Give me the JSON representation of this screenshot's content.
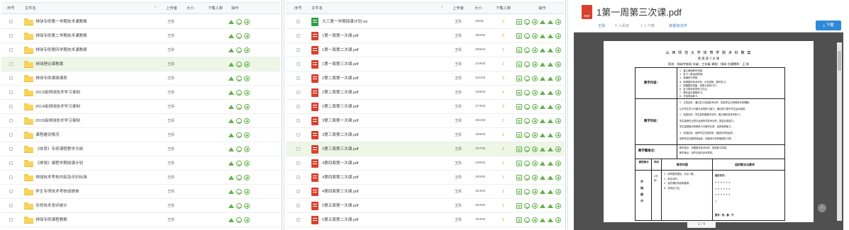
{
  "left": {
    "headers": {
      "index": "序号",
      "filename": "文件名",
      "uploader": "上传者",
      "size": "大小",
      "downloads": "下载人数",
      "actions": "操作"
    },
    "rows": [
      {
        "name": "排球专修第一学期技术课教案",
        "uploader": "王彤",
        "size": "",
        "downloads": ""
      },
      {
        "name": "排球专修第二学期技术课教案",
        "uploader": "王彤",
        "size": "",
        "downloads": ""
      },
      {
        "name": "排球专修第四学期技术课教案",
        "uploader": "王彤",
        "size": "",
        "downloads": ""
      },
      {
        "name": "排球理论课教案",
        "uploader": "王彤",
        "size": "",
        "downloads": ""
      },
      {
        "name": "排球专修课授课表",
        "uploader": "王彤",
        "size": "",
        "downloads": ""
      },
      {
        "name": "2013级排球技术学习录制",
        "uploader": "王彤",
        "size": "",
        "downloads": ""
      },
      {
        "name": "2014级排球技术学习录制",
        "uploader": "王彤",
        "size": "",
        "downloads": ""
      },
      {
        "name": "2015级排球技术学习录制",
        "uploader": "王彤",
        "size": "",
        "downloads": ""
      },
      {
        "name": "课程建设情况",
        "uploader": "王彤",
        "size": "",
        "downloads": ""
      },
      {
        "name": "《体育》专修课程教学大纲",
        "uploader": "王彤",
        "size": "",
        "downloads": ""
      },
      {
        "name": "《排球》课程学期授课计划",
        "uploader": "王彤",
        "size": "",
        "downloads": ""
      },
      {
        "name": "排球技术考核内容及评价标准",
        "uploader": "王彤",
        "size": "",
        "downloads": ""
      },
      {
        "name": "学生专项技术考核成绩单",
        "uploader": "王彤",
        "size": "",
        "downloads": ""
      },
      {
        "name": "专修技术测评统计",
        "uploader": "王彤",
        "size": "",
        "downloads": ""
      },
      {
        "name": "排球专修课程教案",
        "uploader": "王彤",
        "size": "",
        "downloads": ""
      }
    ]
  },
  "middle": {
    "headers": {
      "index": "序号",
      "filename": "文件名",
      "uploader": "上传者",
      "size": "大小",
      "downloads": "下载人数",
      "actions": "操作"
    },
    "rows": [
      {
        "name": "大三第一学期授课计划.xls",
        "type": "xls",
        "uploader": "王彤",
        "size": "28KB",
        "downloads": "0"
      },
      {
        "name": "1第一周第一次课.pdf",
        "type": "pdf",
        "uploader": "王彤",
        "size": "300KB",
        "downloads": "0"
      },
      {
        "name": "1第一周第二次课.pdf",
        "type": "pdf",
        "uploader": "王彤",
        "size": "305KB",
        "downloads": "1"
      },
      {
        "name": "1第一周第三次课.pdf",
        "type": "pdf",
        "uploader": "王彤",
        "size": "319KB",
        "downloads": "2"
      },
      {
        "name": "2第二周第一次课.pdf",
        "type": "pdf",
        "uploader": "王彤",
        "size": "341KB",
        "downloads": "3"
      },
      {
        "name": "2第二周第二次课.pdf",
        "type": "pdf",
        "uploader": "王彤",
        "size": "266KB",
        "downloads": "2"
      },
      {
        "name": "2第二周第三次课.pdf",
        "type": "pdf",
        "uploader": "王彤",
        "size": "273KB",
        "downloads": "3"
      },
      {
        "name": "3第三周第一次课.pdf",
        "type": "pdf",
        "uploader": "王彤",
        "size": "351KB",
        "downloads": "2"
      },
      {
        "name": "3第三周第二次课.pdf",
        "type": "pdf",
        "uploader": "王彤",
        "size": "359KB",
        "downloads": "2"
      },
      {
        "name": "3第三周第三次课.pdf",
        "type": "pdf",
        "uploader": "王彤",
        "size": "327KB",
        "downloads": "2"
      },
      {
        "name": "4第四周第一次课.pdf",
        "type": "pdf",
        "uploader": "王彤",
        "size": "246KB",
        "downloads": "1"
      },
      {
        "name": "4第四周第二次课.pdf",
        "type": "pdf",
        "uploader": "王彤",
        "size": "262KB",
        "downloads": "1"
      },
      {
        "name": "4第四周第三次课.pdf",
        "type": "pdf",
        "uploader": "王彤",
        "size": "264KB",
        "downloads": "1"
      },
      {
        "name": "5第五周第一次课.pdf",
        "type": "pdf",
        "uploader": "王彤",
        "size": "302KB",
        "downloads": "1"
      },
      {
        "name": "5第五周第二次课.pdf",
        "type": "pdf",
        "uploader": "王彤",
        "size": "293KB",
        "downloads": "1"
      }
    ]
  },
  "preview": {
    "title": "1第一周第三次课.pdf",
    "file_badge": "PDF",
    "uploader": "王彤",
    "views": "0 人阅读",
    "downloads": "1 人下载",
    "report_link": "举报该文件",
    "download_button": "下载",
    "pager": "1 / 4",
    "sidebar_toggle": "‹",
    "doc": {
      "title": "山 西 师 范 大 学 体 育 学 院 术 科 教 案",
      "subtitle": "第    周      第 3 次 课",
      "info": "系别：排球专修班   年级：三年级     课程：排球    任课教师：王  彤",
      "label_content": "教学内容：",
      "content_lines": [
        "1．建立网络教学流程；",
        "2．复习一般运动规律；",
        "3．准确进行考核；",
        "4．网球基本技术动作，示范讲练，循环复习；",
        "5．把握整体进度，讲授计划执行中；",
        "6．复习规范科学练习方法；",
        "7．理论结合课堂练习；",
        "8．总结提高练习。"
      ],
      "label_goal": "教学目标：",
      "goal_lines": [
        "1．认知目标：通过复习巩固技术动作，提高学生对排球技术的理解；",
        "认识学生学习兴趣与自觉练习能力；通过练习提升学生运动素质。",
        "2．技能目标：学生能掌握基本动作，能正确完成技术练习；",
        "学生能够在比赛中运用所学技术动作，提高比赛能力；",
        "学生能够组织简单练习与教学比赛，培养指导能力。",
        "3．情感目标：培养学生吃苦耐劳、团结协作的品质；",
        "培养学生热爱排球运动，积极参与体育锻炼的习惯。"
      ],
      "label_key": "教学重难点：",
      "key_lines": [
        "教学重点：掌握基本技术动作，提高练习质量；",
        "教学难点：动作协调与技术规范。"
      ],
      "col_part": "课的部分",
      "col_time": "时间",
      "col_content": "教学内容",
      "col_method": "组织教法与要求",
      "part_start": "开始部分",
      "start_lines": [
        "1．体育委员整队，清点人数；",
        "2．师生问好；",
        "3．宣布课的内容和要求；",
        "4．安排见习生；"
      ],
      "time_start": "2分钟",
      "formation_title": "组织形式：",
      "formation_rows": [
        "× × × × × ×",
        "× × × × × ×",
        "× × × × × ×",
        "△"
      ],
      "requirement": "要求：快、静、齐"
    }
  }
}
